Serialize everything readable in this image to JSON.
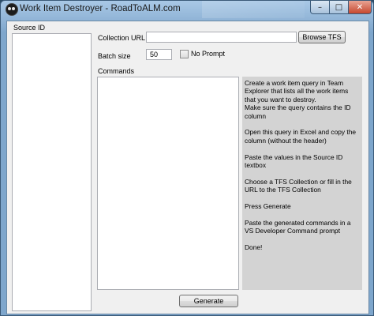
{
  "window": {
    "title": "Work Item Destroyer - RoadToALM.com",
    "minimize_glyph": "–",
    "maximize_glyph": "□",
    "close_glyph": "✕"
  },
  "source": {
    "label": "Source ID",
    "value": ""
  },
  "collection": {
    "label": "Collection URL",
    "value": "",
    "browse_label": "Browse TFS"
  },
  "batch": {
    "label": "Batch size",
    "value": "50"
  },
  "no_prompt": {
    "label": "No Prompt",
    "checked": false
  },
  "commands": {
    "label": "Commands",
    "value": ""
  },
  "instructions": [
    "Create a work item query in Team Explorer that lists all the work items that you want to destroy.\nMake sure the query contains the ID column",
    "Open this query in Excel and copy the column (without the header)",
    "Paste the values in the Source ID textbox",
    "Choose a TFS Collection or fill in the URL to the TFS Collection",
    "Press Generate",
    "Paste the generated commands in a VS Developer Command prompt",
    "Done!"
  ],
  "generate_label": "Generate",
  "colors": {
    "instructions_bg": "#d3d3d3",
    "close_button": "#c7482f"
  }
}
